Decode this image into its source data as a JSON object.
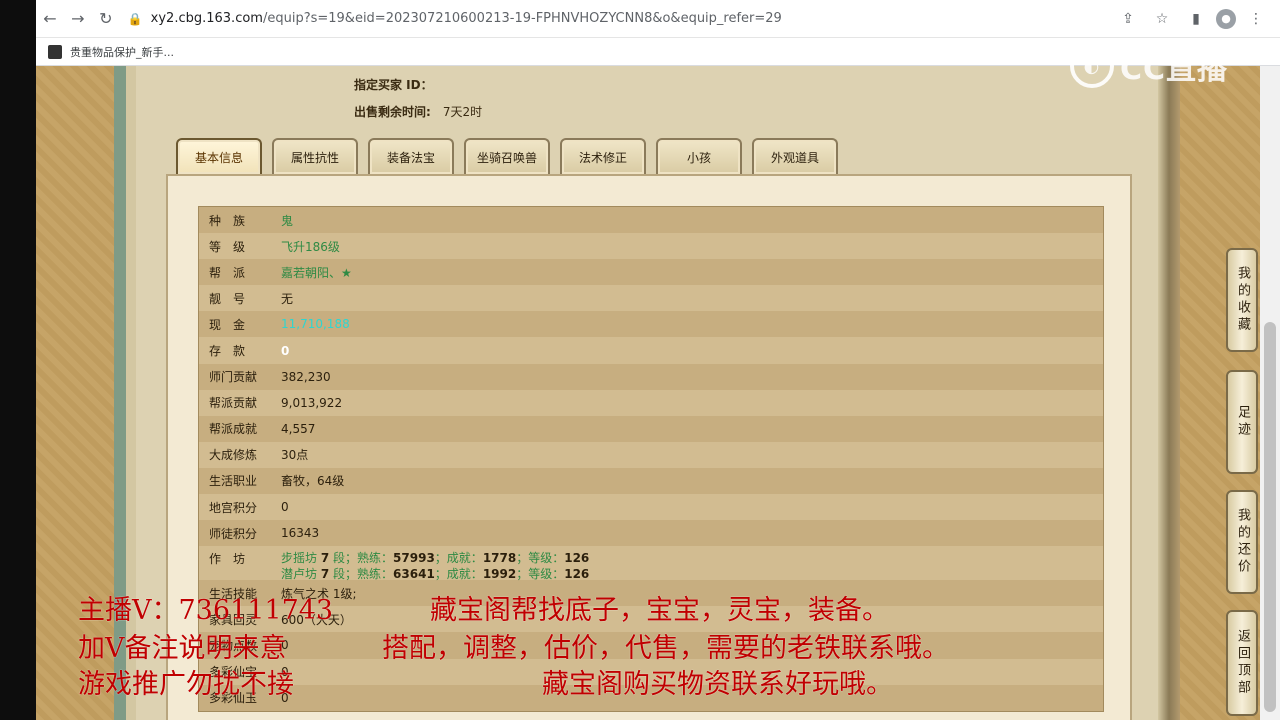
{
  "browser": {
    "url_domain": "xy2.cbg.163.com",
    "url_path": "/equip?s=19&eid=202307210600213-19-FPHNVHOZYCNN8&o&equip_refer=29",
    "bookmark": "贵重物品保护_新手..."
  },
  "meta": {
    "buyer_label": "指定买家 ID：",
    "buyer_value": "",
    "time_label": "出售剩余时间:",
    "time_value": "7天2时"
  },
  "tabs": [
    "基本信息",
    "属性抗性",
    "装备法宝",
    "坐骑召唤兽",
    "法术修正",
    "小孩",
    "外观道具"
  ],
  "rows": [
    {
      "k": "种　族",
      "v": "鬼"
    },
    {
      "k": "等　级",
      "v": "飞升186级"
    },
    {
      "k": "帮　派",
      "v": "嘉若朝阳、★"
    },
    {
      "k": "靓　号",
      "v": "无"
    },
    {
      "k": "现　金",
      "v": "11,710,188"
    },
    {
      "k": "存　款",
      "v": "0"
    },
    {
      "k": "师门贡献",
      "v": "382,230"
    },
    {
      "k": "帮派贡献",
      "v": "9,013,922"
    },
    {
      "k": "帮派成就",
      "v": "4,557"
    },
    {
      "k": "大成修炼",
      "v": "30点"
    },
    {
      "k": "生活职业",
      "v": "畜牧，64级"
    },
    {
      "k": "地宫积分",
      "v": "0"
    },
    {
      "k": "师徒积分",
      "v": "16343"
    }
  ],
  "workshop": {
    "k": "作　坊",
    "line1": {
      "a": "步摇坊",
      "b": "7",
      "c": "段；熟练：",
      "d": "57993",
      "e": "；成就：",
      "f": "1778",
      "g": "；等级：",
      "h": "126"
    },
    "line2": {
      "a": "潜卢坊",
      "b": "7",
      "c": "段；熟练：",
      "d": "63641",
      "e": "；成就：",
      "f": "1992",
      "g": "；等级：",
      "h": "126"
    }
  },
  "partial_rows": [
    {
      "k": "生活技能",
      "v": "炼气之术 1级;"
    },
    {
      "k": "家具回灵",
      "v": "600（大天）"
    },
    {
      "k": "宠物点数",
      "v": "0"
    },
    {
      "k": "多彩仙宝",
      "v": "0"
    },
    {
      "k": "多彩仙玉",
      "v": "0"
    }
  ],
  "side_buttons": [
    "我的收藏",
    "足迹",
    "我的还价",
    "返回顶部"
  ],
  "watermark": "CC直播",
  "overlay": {
    "line1a": "主播V：736111743",
    "line1b": "藏宝阁帮找底子，宝宝，灵宝，装备。",
    "line2a": "加V备注说明来意",
    "line2b": "搭配，调整，估价，代售，需要的老铁联系哦。",
    "line3a": "游戏推广勿扰不接",
    "line3b": "藏宝阁购买物资联系好玩哦。"
  }
}
